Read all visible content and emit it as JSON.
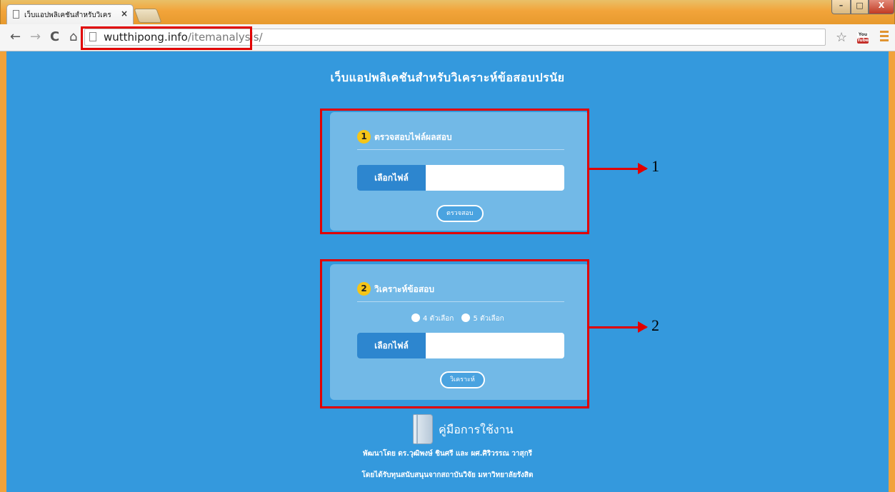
{
  "browser": {
    "tab_title": "เว็บแอปพลิเคชันสำหรับวิเคร",
    "tab_close": "×",
    "url_domain": "wutthipong.info",
    "url_path": "/itemanalysis/",
    "win_min": "–",
    "win_max": "□",
    "win_close": "X",
    "nav_back": "←",
    "nav_forward": "→",
    "nav_reload": "C",
    "nav_home": "⌂",
    "bookmark_star": "☆",
    "youtube_you": "You",
    "youtube_tube": "Tube"
  },
  "page": {
    "title": "เว็บแอปพลิเคชันสำหรับวิเคราะห์ข้อสอบปรนัย"
  },
  "step1": {
    "number": "1",
    "label": "ตรวจสอบไฟล์ผลสอบ",
    "file_button": "เลือกไฟล์",
    "submit": "ตรวจสอบ"
  },
  "step2": {
    "number": "2",
    "label": "วิเคราะห์ข้อสอบ",
    "option_4": "4 ตัวเลือก",
    "option_5": "5 ตัวเลือก",
    "file_button": "เลือกไฟล์",
    "submit": "วิเคราะห์"
  },
  "manual": {
    "label": "คู่มือการใช้งาน"
  },
  "credits": {
    "line1": "พัฒนาโดย ดร.วุฒิพงษ์ ชินศรี และ ผศ.ศิริวรรณ วาสุกรี",
    "line2": "โดยได้รับทุนสนับสนุนจากสถาบันวิจัย มหาวิทยาลัยรังสิต"
  },
  "annotations": {
    "arrow1": "1",
    "arrow2": "2"
  },
  "colors": {
    "page_bg": "#3499dd",
    "panel_bg": "#72b9e7",
    "file_button": "#2d86cf",
    "step_badge": "#f5c518",
    "highlight": "#e10000"
  }
}
